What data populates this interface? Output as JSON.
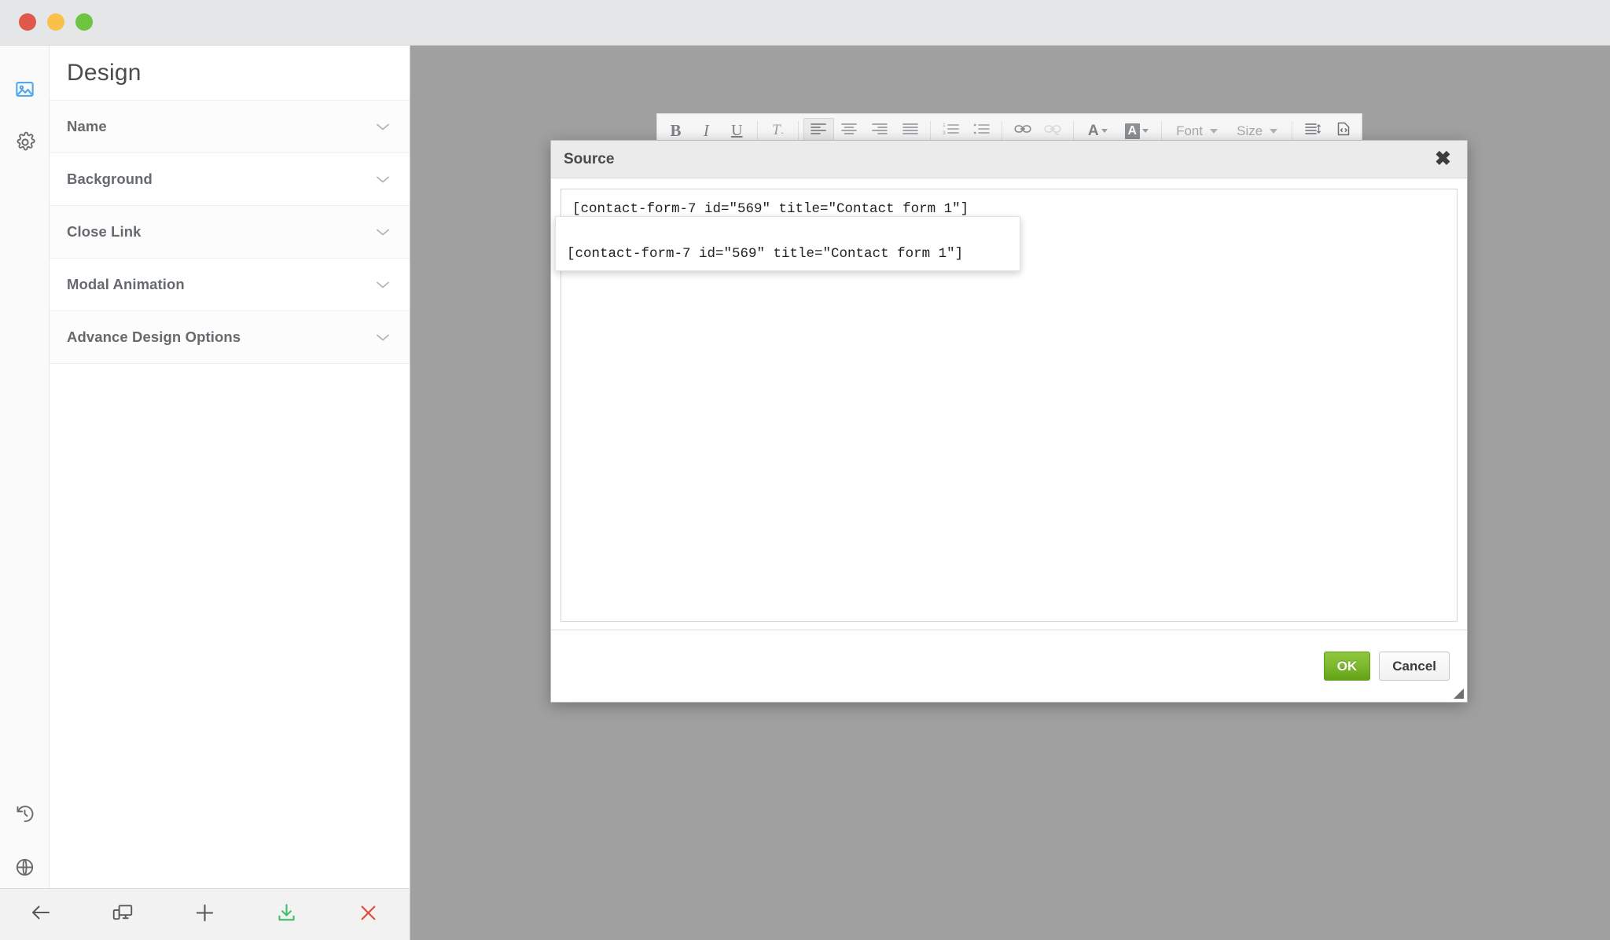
{
  "window": {
    "controls": [
      {
        "name": "close",
        "color": "#e0574c"
      },
      {
        "name": "minimize",
        "color": "#fbc04a"
      },
      {
        "name": "maximize",
        "color": "#6ec441"
      }
    ]
  },
  "icon_rail": {
    "top_items": [
      {
        "icon": "image-icon",
        "label": "Design",
        "active": true
      },
      {
        "icon": "gear-icon",
        "label": "Settings",
        "active": false
      }
    ],
    "bottom_items": [
      {
        "icon": "history-icon",
        "label": "Revisions",
        "active": false
      },
      {
        "icon": "globe-icon",
        "label": "Global",
        "active": false
      }
    ]
  },
  "panel": {
    "title": "Design",
    "sections": [
      {
        "label": "Name",
        "expanded": false
      },
      {
        "label": "Background",
        "expanded": false
      },
      {
        "label": "Close Link",
        "expanded": false
      },
      {
        "label": "Modal Animation",
        "expanded": false
      },
      {
        "label": "Advance Design Options",
        "expanded": false
      }
    ]
  },
  "bottom_toolbar": {
    "buttons": [
      {
        "icon": "arrow-left-icon",
        "label": "Back",
        "color": "#58585a"
      },
      {
        "icon": "responsive-preview-icon",
        "label": "Responsive Preview",
        "color": "#58585a"
      },
      {
        "icon": "plus-icon",
        "label": "Add",
        "color": "#58585a"
      },
      {
        "icon": "download-icon",
        "label": "Save",
        "color": "#3fbf63"
      },
      {
        "icon": "close-x-icon",
        "label": "Close",
        "color": "#e04b3c"
      }
    ]
  },
  "editor_toolbar": {
    "groups": [
      {
        "items": [
          {
            "icon": "bold-icon",
            "label": "Bold",
            "glyph": "B",
            "state": "normal"
          },
          {
            "icon": "italic-icon",
            "label": "Italic",
            "glyph": "I",
            "state": "normal"
          },
          {
            "icon": "underline-icon",
            "label": "Underline",
            "glyph": "U",
            "state": "normal"
          }
        ]
      },
      {
        "items": [
          {
            "icon": "remove-format-icon",
            "label": "Remove Format",
            "glyph": "Tx",
            "state": "normal"
          }
        ]
      },
      {
        "items": [
          {
            "icon": "align-left-icon",
            "label": "Align Left",
            "state": "active"
          },
          {
            "icon": "align-center-icon",
            "label": "Center",
            "state": "normal"
          },
          {
            "icon": "align-right-icon",
            "label": "Align Right",
            "state": "normal"
          },
          {
            "icon": "align-justify-icon",
            "label": "Justify",
            "state": "normal"
          }
        ]
      },
      {
        "items": [
          {
            "icon": "numbered-list-icon",
            "label": "Insert/Remove Numbered List",
            "state": "normal"
          },
          {
            "icon": "bulleted-list-icon",
            "label": "Insert/Remove Bulleted List",
            "state": "normal"
          }
        ]
      },
      {
        "items": [
          {
            "icon": "link-icon",
            "label": "Link",
            "state": "normal"
          },
          {
            "icon": "unlink-icon",
            "label": "Unlink",
            "state": "disabled"
          }
        ]
      },
      {
        "items": [
          {
            "icon": "text-color-icon",
            "label": "Text Color",
            "glyph": "A",
            "state": "normal"
          },
          {
            "icon": "background-color-icon",
            "label": "Background Color",
            "glyph": "A",
            "state": "normal"
          }
        ]
      }
    ],
    "combos": [
      {
        "icon": "font-dropdown",
        "label": "Font"
      },
      {
        "icon": "size-dropdown",
        "label": "Size"
      }
    ],
    "tail": [
      {
        "icon": "line-height-icon",
        "label": "Line Height",
        "state": "normal"
      },
      {
        "icon": "source-code-icon",
        "label": "Source",
        "state": "normal"
      }
    ]
  },
  "modal": {
    "title": "Source",
    "close_label": "✖",
    "source_value": "[contact-form-7 id=\"569\" title=\"Contact form 1\"]",
    "source_placeholder": "",
    "popup_text": "[contact-form-7 id=\"569\" title=\"Contact form 1\"]",
    "ok_label": "OK",
    "cancel_label": "Cancel",
    "accent_ok": "#7cb82f"
  }
}
